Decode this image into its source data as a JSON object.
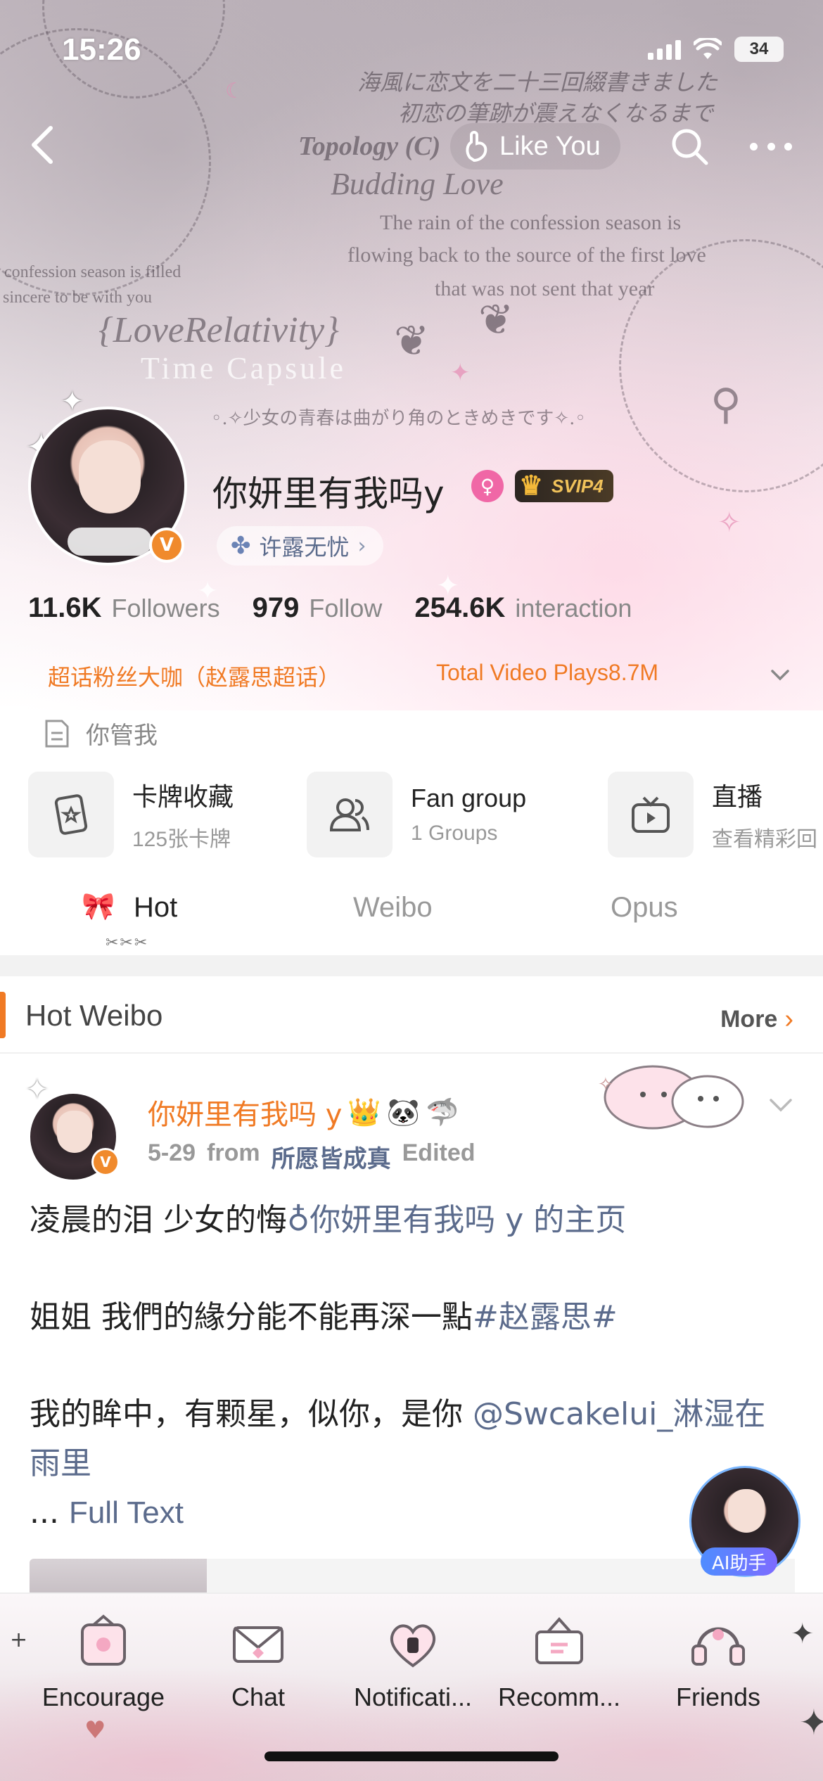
{
  "status_bar": {
    "time": "15:26",
    "battery": "34"
  },
  "banner": {
    "art_text": {
      "jp_line1": "海風に恋文を二十三回綴書きました",
      "jp_line2": "初恋の筆跡が震えなくなるまで",
      "topology": "Topology (C)",
      "budding": "Budding Love",
      "rain_1": "The rain of the confession season is",
      "rain_2": "flowing back to the source of the first love",
      "rain_3": "that was not sent that year",
      "side_1": "confession season is filled",
      "side_2": "sincere to be with you",
      "love_relativity": "{LoveRelativity}",
      "time_capsule": "Time Capsule",
      "jp_bottom": "◦.✧少女の青春は曲がり角のときめきです✧.◦"
    }
  },
  "nav": {
    "like_you_label": "Like You"
  },
  "profile": {
    "name": "你妍里有我吗y",
    "svip_label": "SVIP4",
    "group_label": "许露无忧",
    "stats": [
      {
        "num": "11.6K",
        "label": "Followers"
      },
      {
        "num": "979",
        "label": "Follow"
      },
      {
        "num": "254.6K",
        "label": "interaction"
      }
    ],
    "super_topic": "超话粉丝大咖（赵露思超话）",
    "video_plays": "Total Video Plays8.7M",
    "bio": "你管我"
  },
  "features": [
    {
      "title": "卡牌收藏",
      "sub": "125张卡牌",
      "icon": "card-icon"
    },
    {
      "title": "Fan group",
      "sub": "1 Groups",
      "icon": "group-icon"
    },
    {
      "title": "直播",
      "sub": "查看精彩回",
      "icon": "tv-icon"
    }
  ],
  "tabs": [
    {
      "label": "Hot",
      "active": true
    },
    {
      "label": "Weibo",
      "active": false
    },
    {
      "label": "Opus",
      "active": false
    }
  ],
  "hot_section": {
    "title": "Hot Weibo",
    "more_label": "More"
  },
  "post": {
    "author": "你妍里有我吗 y",
    "date": "5-29",
    "from_label": "from",
    "source": "所愿皆成真",
    "edited": "Edited",
    "line1_text": "凌晨的泪 少女的悔",
    "line1_link": "你妍里有我吗 y 的主页",
    "line2_text": "姐姐 我們的緣分能不能再深一點",
    "line2_tag": "#赵露思#",
    "line3_text": "我的眸中，有颗星，似你，是你 ",
    "line3_mention": "@Swcakelui_淋湿在雨里",
    "ellipsis": "... ",
    "full_text": "Full Text"
  },
  "ai_assistant": {
    "label": "AI助手"
  },
  "tabbar": [
    {
      "label": "Encourage",
      "icon": "encourage-icon"
    },
    {
      "label": "Chat",
      "icon": "chat-icon"
    },
    {
      "label": "Notificati...",
      "icon": "notification-icon"
    },
    {
      "label": "Recomm...",
      "icon": "recommend-icon"
    },
    {
      "label": "Friends",
      "icon": "friends-icon"
    }
  ],
  "colors": {
    "accent_orange": "#f07a24",
    "link_blue": "#5b6b8c",
    "svip_gold": "#f0c25a"
  }
}
